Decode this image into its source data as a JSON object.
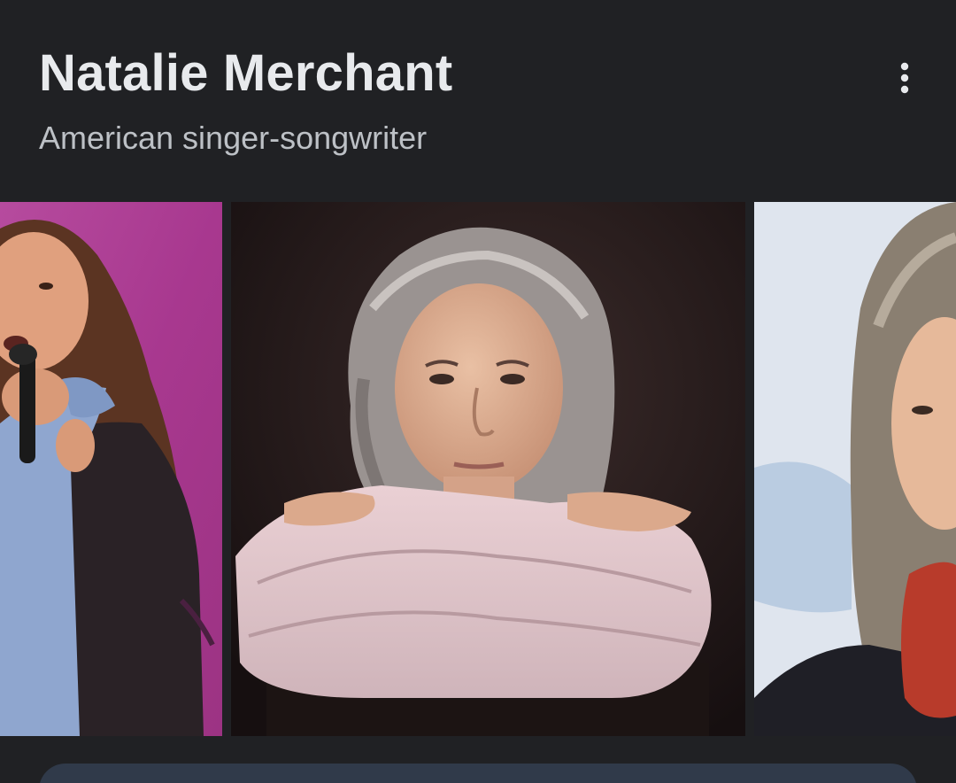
{
  "header": {
    "title": "Natalie Merchant",
    "subtitle": "American singer-songwriter"
  },
  "menu": {
    "icon": "more-vert-icon"
  },
  "gallery": {
    "images": [
      {
        "name": "image-singing-with-microphone"
      },
      {
        "name": "image-portrait-arms-crossed"
      },
      {
        "name": "image-portrait-red-scarf"
      }
    ]
  },
  "colors": {
    "background": "#202124",
    "title": "#e8eaed",
    "subtitle": "#bdc1c6",
    "card": "#303a4a"
  }
}
